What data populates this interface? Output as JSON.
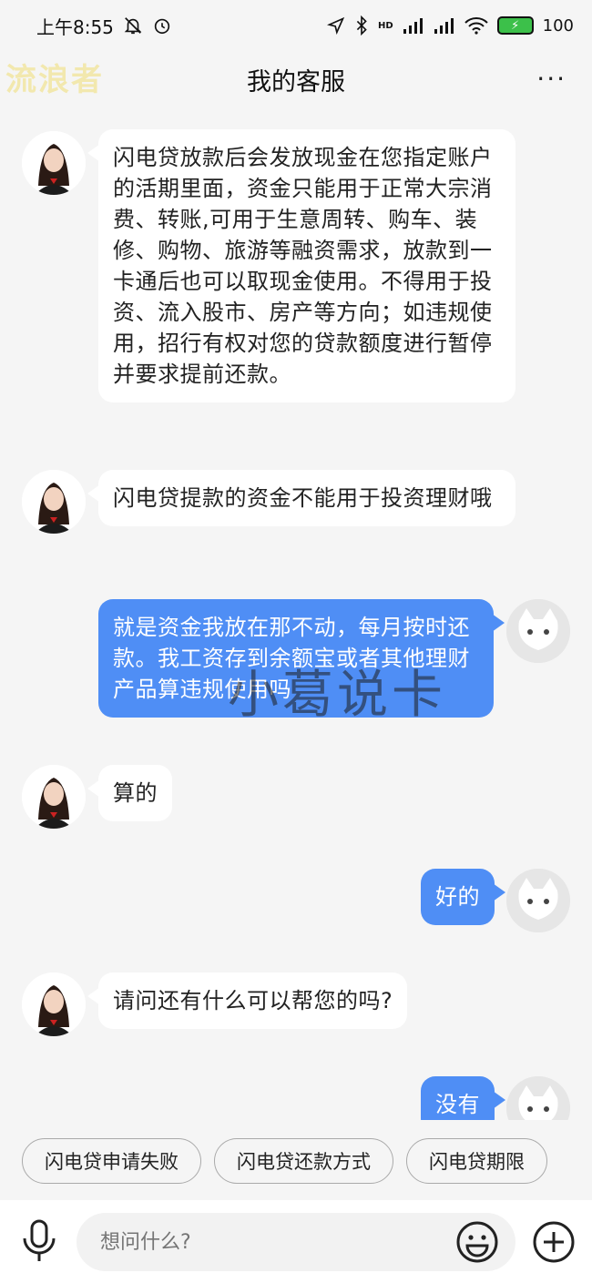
{
  "status_bar": {
    "time": "上午8:55",
    "icons": [
      "mute-bell-icon",
      "alarm-icon",
      "location-icon",
      "bluetooth-icon",
      "signal-icon",
      "wifi-icon"
    ],
    "hd": "HD",
    "battery": "100"
  },
  "header": {
    "title": "我的客服",
    "more": "···",
    "watermark": "流浪者"
  },
  "messages": [
    {
      "side": "left",
      "text": "闪电贷放款后会发放现金在您指定账户的活期里面，资金只能用于正常大宗消费、转账,可用于生意周转、购车、装修、购物、旅游等融资需求，放款到一卡通后也可以取现金使用。不得用于投资、流入股市、房产等方向；如违规使用，招行有权对您的贷款额度进行暂停并要求提前还款。"
    },
    {
      "side": "left",
      "text": "闪电贷提款的资金不能用于投资理财哦"
    },
    {
      "side": "right",
      "text": "就是资金我放在那不动，每月按时还款。我工资存到余额宝或者其他理财产品算违规使用吗"
    },
    {
      "side": "left",
      "text": "算的"
    },
    {
      "side": "right",
      "text": "好的"
    },
    {
      "side": "left",
      "text": "请问还有什么可以帮您的吗?"
    },
    {
      "side": "right",
      "text": "没有"
    }
  ],
  "overlay_watermark": "小葛说卡",
  "quick_replies": [
    "闪电贷申请失败",
    "闪电贷还款方式",
    "闪电贷期限"
  ],
  "input": {
    "placeholder": "想问什么?"
  },
  "colors": {
    "user_bubble": "#4f8ef5",
    "agent_bubble": "#ffffff",
    "background": "#f5f5f5"
  }
}
